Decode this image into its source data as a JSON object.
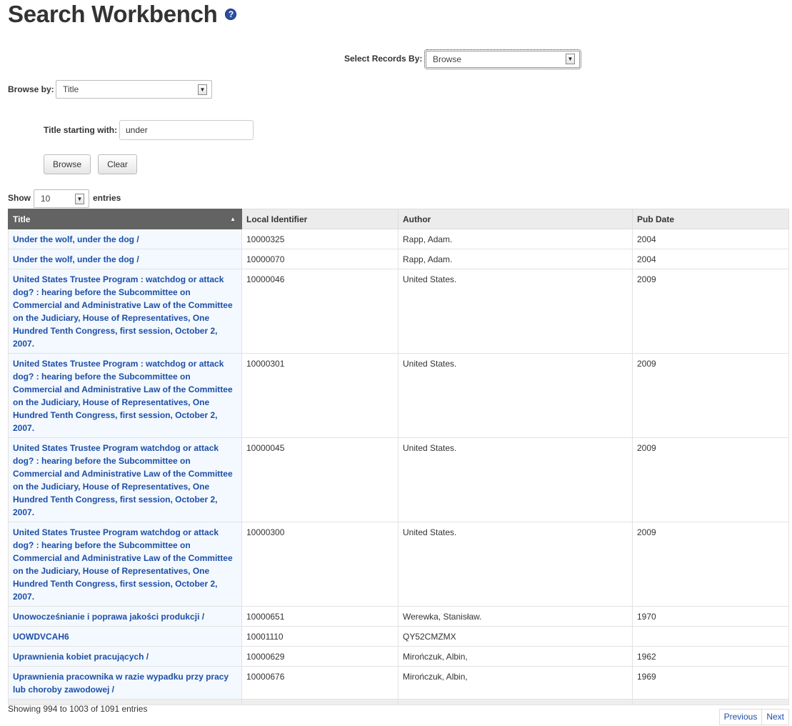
{
  "page": {
    "title": "Search Workbench",
    "help_icon": "?"
  },
  "select_records": {
    "label": "Select Records By:",
    "value": "Browse"
  },
  "browse_by": {
    "label": "Browse by:",
    "value": "Title"
  },
  "title_filter": {
    "label": "Title starting with:",
    "value": "under"
  },
  "buttons": {
    "browse": "Browse",
    "clear": "Clear"
  },
  "length": {
    "show_label": "Show",
    "value": "10",
    "entries_label": "entries"
  },
  "table": {
    "columns": [
      "Title",
      "Local Identifier",
      "Author",
      "Pub Date"
    ],
    "rows": [
      {
        "title": "Under the wolf, under the dog /",
        "id": "10000325",
        "author": "Rapp, Adam.",
        "date": "2004"
      },
      {
        "title": "Under the wolf, under the dog /",
        "id": "10000070",
        "author": "Rapp, Adam.",
        "date": "2004"
      },
      {
        "title": "United States Trustee Program : watchdog or attack dog? : hearing before the Subcommittee on Commercial and Administrative Law of the Committee on the Judiciary, House of Representatives, One Hundred Tenth Congress, first session, October 2, 2007.",
        "id": "10000046",
        "author": "United States.",
        "date": "2009"
      },
      {
        "title": "United States Trustee Program : watchdog or attack dog? : hearing before the Subcommittee on Commercial and Administrative Law of the Committee on the Judiciary, House of Representatives, One Hundred Tenth Congress, first session, October 2, 2007.",
        "id": "10000301",
        "author": "United States.",
        "date": "2009"
      },
      {
        "title": "United States Trustee Program watchdog or attack dog? : hearing before the Subcommittee on Commercial and Administrative Law of the Committee on the Judiciary, House of Representatives, One Hundred Tenth Congress, first session, October 2, 2007.",
        "id": "10000045",
        "author": "United States.",
        "date": "2009"
      },
      {
        "title": "United States Trustee Program watchdog or attack dog? : hearing before the Subcommittee on Commercial and Administrative Law of the Committee on the Judiciary, House of Representatives, One Hundred Tenth Congress, first session, October 2, 2007.",
        "id": "10000300",
        "author": "United States.",
        "date": "2009"
      },
      {
        "title": "Unowocześnianie i poprawa jakości produkcji /",
        "id": "10000651",
        "author": "Werewka, Stanisław.",
        "date": "1970"
      },
      {
        "title": "UOWDVCAH6",
        "id": "10001110",
        "author": "QY52CMZMX",
        "date": ""
      },
      {
        "title": "Uprawnienia kobiet pracujących /",
        "id": "10000629",
        "author": "Mirończuk, Albin,",
        "date": "1962"
      },
      {
        "title": "Uprawnienia pracownika w razie wypadku przy pracy lub choroby zawodowej /",
        "id": "10000676",
        "author": "Mirończuk, Albin,",
        "date": "1969"
      }
    ]
  },
  "info": "Showing 994 to 1003 of 1091 entries",
  "pager": {
    "previous": "Previous",
    "next": "Next"
  }
}
